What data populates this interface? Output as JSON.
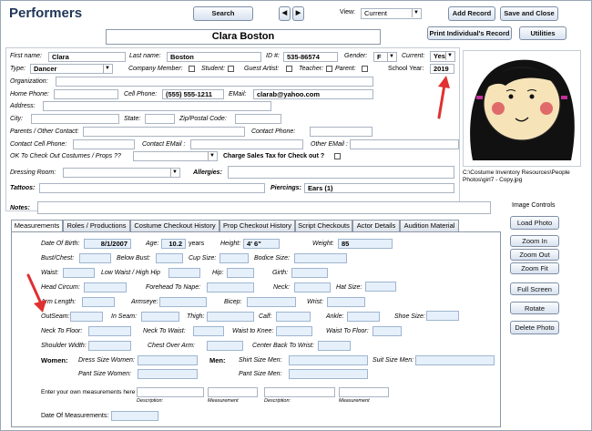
{
  "header": {
    "title": "Performers",
    "search": "Search",
    "prev": "◀",
    "next": "▶",
    "view_label": "View:",
    "view_value": "Current",
    "add_record": "Add Record",
    "save_close": "Save and Close",
    "print": "Print Individual's Record",
    "utilities": "Utilities",
    "name_display": "Clara Boston"
  },
  "person": {
    "first_name_label": "First name:",
    "first_name": "Clara",
    "last_name_label": "Last name:",
    "last_name": "Boston",
    "id_label": "ID #:",
    "id": "535-86574",
    "gender_label": "Gender:",
    "gender": "F",
    "current_label": "Current:",
    "current": "Yes",
    "type_label": "Type:",
    "type": "Dancer",
    "company_member": "Company Member:",
    "student": "Student:",
    "guest_artist": "Guest Artist:",
    "teacher": "Teacher:",
    "parent": "Parent:",
    "school_year_label": "School Year:",
    "school_year": "2019",
    "organization": "Organization:",
    "home_phone": "Home Phone:",
    "cell_phone_label": "Cell Phone:",
    "cell_phone": "(555) 555-1211",
    "email_label": "EMail:",
    "email": "clarab@yahoo.com",
    "address": "Address:",
    "city": "City:",
    "state": "State:",
    "zip": "Zip/Postal Code:",
    "parents_contact": "Parents / Other Contact:",
    "contact_phone": "Contact Phone:",
    "contact_cell": "Contact Cell Phone:",
    "contact_email": "Contact EMail :",
    "other_email": "Other EMail :",
    "ok_checkout": "OK To Check Out Costumes / Props ??",
    "charge_tax": "Charge Sales Tax for Check out ?",
    "dressing_room": "Dressing Room:",
    "allergies": "Allergies:",
    "tattoos": "Tattoos:",
    "piercings_label": "Piercings:",
    "piercings": "Ears (1)",
    "notes": "Notes:"
  },
  "photo": {
    "path": "C:\\Costume Inventory Resources\\People Photos\\girl7 - Copy.jpg",
    "controls_title": "Image Controls",
    "load": "Load Photo",
    "zoom_in": "Zoom In",
    "zoom_out": "Zoom Out",
    "zoom_fit": "Zoom Fit",
    "full_screen": "Full Screen",
    "rotate": "Rotate",
    "delete": "Delete Photo"
  },
  "tabs": [
    "Measurements",
    "Roles / Productions",
    "Costume Checkout History",
    "Prop Checkout History",
    "Script Checkouts",
    "Actor Details",
    "Audition Material"
  ],
  "meas": {
    "dob_label": "Date Of Birth:",
    "dob": "8/1/2007",
    "age_label": "Age:",
    "age": "10.2",
    "years": "years",
    "height_label": "Height:",
    "height": "4' 6\"",
    "weight_label": "Weight:",
    "weight": "85",
    "bust": "Bust/Chest:",
    "below_bust": "Below Bust:",
    "cup": "Cup Size:",
    "bodice": "Bodice Size:",
    "waist": "Waist:",
    "low_waist": "Low Waist / High Hip",
    "hip": "Hip:",
    "girth": "Girth:",
    "head": "Head Circum:",
    "forehead": "Forehead To Nape:",
    "neck": "Neck:",
    "hat": "Hat Size:",
    "arm": "Arm Length:",
    "armseye": "Armseye:",
    "bicep": "Bicep:",
    "wrist": "Wrist:",
    "outseam": "OutSeam:",
    "inseam": "In Seam:",
    "thigh": "Thigh:",
    "calf": "Calf:",
    "ankle": "Ankle:",
    "shoe": "Shoe Size:",
    "neck_floor": "Neck To Floor:",
    "neck_waist": "Neck To Waist:",
    "waist_knee": "Waist to Knee:",
    "waist_floor": "Waist To Floor:",
    "shoulder": "Shoulder Width:",
    "chest_arm": "Chest Over Arm:",
    "center_back": "Center Back To Wrist:",
    "women": "Women:",
    "dress_women": "Dress Size Women:",
    "men": "Men:",
    "shirt_men": "Shirt Size Men:",
    "suit_men": "Suit Size Men:",
    "pant_women": "Pant Size Women:",
    "pant_men": "Pant Size Men:",
    "own": "Enter your own measurements here",
    "description": "Description:",
    "measurement": "Measurement",
    "date_meas": "Date Of Measurements:"
  }
}
